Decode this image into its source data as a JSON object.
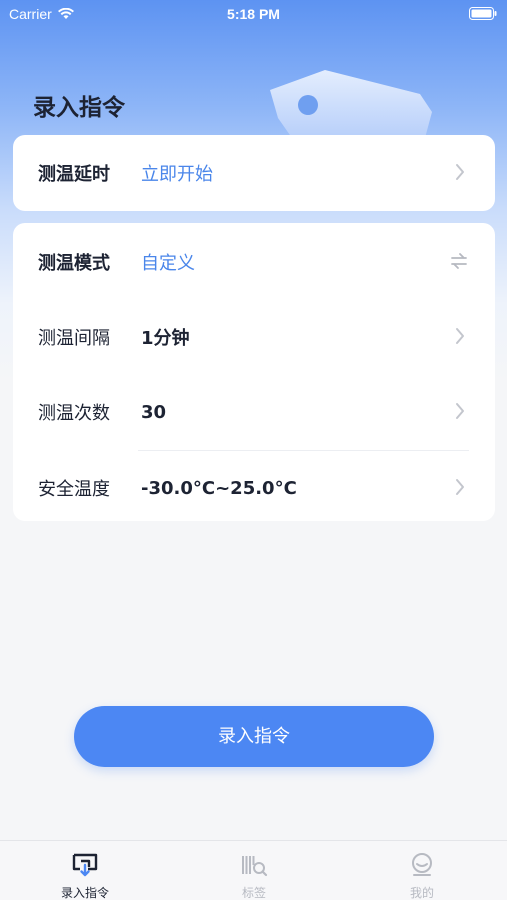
{
  "status_bar": {
    "carrier": "Carrier",
    "time": "5:18 PM"
  },
  "page_title": "录入指令",
  "delay_card": {
    "label": "测温延时",
    "value": "立即开始"
  },
  "settings": [
    {
      "label": "测温模式",
      "value": "自定义"
    },
    {
      "label": "测温间隔",
      "value": "1分钟"
    },
    {
      "label": "测温次数",
      "value": "30"
    },
    {
      "label": "安全温度",
      "value": "-30.0°C~25.0°C"
    }
  ],
  "submit_label": "录入指令",
  "tabs": [
    {
      "label": "录入指令",
      "icon": "enter-command-icon",
      "active": true
    },
    {
      "label": "标签",
      "icon": "tag-scan-icon",
      "active": false
    },
    {
      "label": "我的",
      "icon": "profile-icon",
      "active": false
    }
  ],
  "colors": {
    "accent": "#4c87f3",
    "value_blue": "#4a86ea",
    "text": "#1d2333",
    "inactive": "#b7bac2"
  }
}
